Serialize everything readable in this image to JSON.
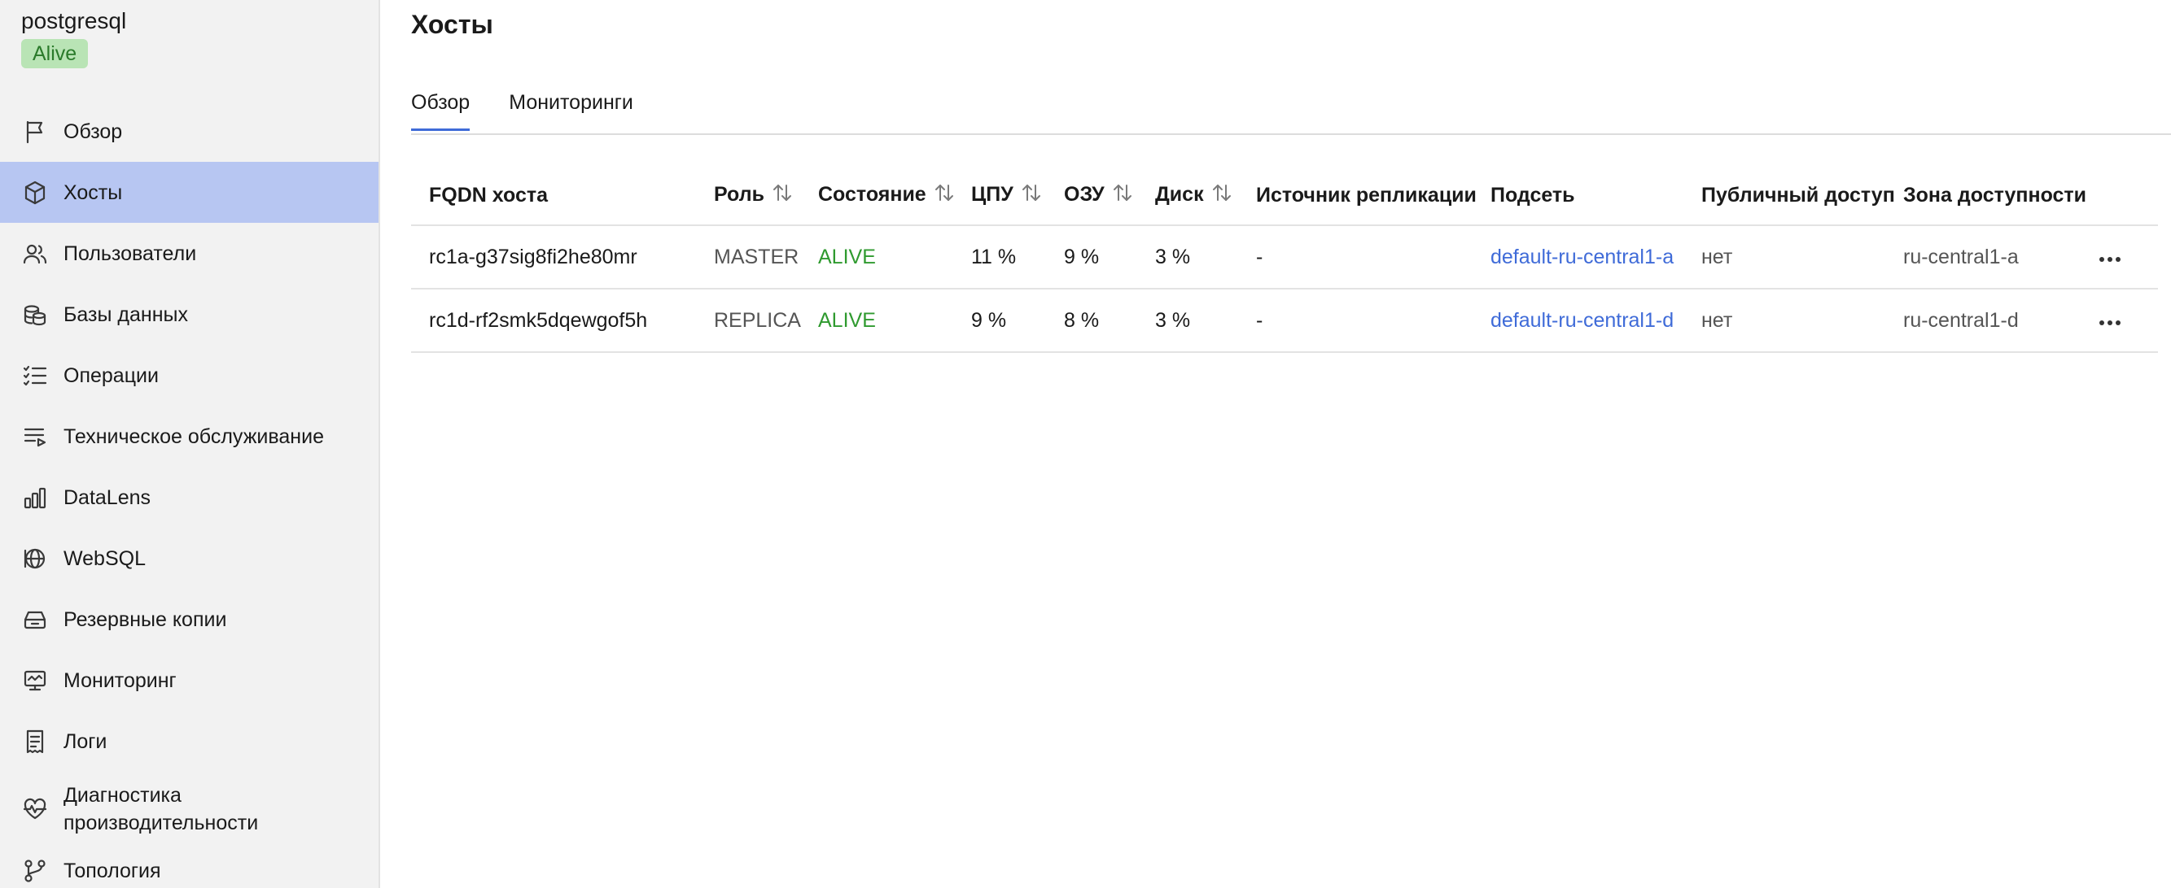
{
  "cluster": {
    "name": "postgresql",
    "status": "Alive"
  },
  "colors": {
    "active_nav": "#b7c6f2",
    "status_green": "#2f9a2f",
    "badge_bg": "#b9e4b5",
    "link": "#3f6bd8",
    "tab_underline": "#3f6bd8"
  },
  "sidebar": {
    "items": [
      {
        "label": "Обзор",
        "icon": "flag-icon"
      },
      {
        "label": "Хосты",
        "icon": "cube-icon",
        "active": true
      },
      {
        "label": "Пользователи",
        "icon": "users-icon"
      },
      {
        "label": "Базы данных",
        "icon": "databases-icon"
      },
      {
        "label": "Операции",
        "icon": "list-check-icon"
      },
      {
        "label": "Техническое обслуживание",
        "icon": "list-play-icon"
      },
      {
        "label": "DataLens",
        "icon": "chart-bars-icon"
      },
      {
        "label": "WebSQL",
        "icon": "globe-icon"
      },
      {
        "label": "Резервные копии",
        "icon": "archive-icon"
      },
      {
        "label": "Мониторинг",
        "icon": "monitor-icon"
      },
      {
        "label": "Логи",
        "icon": "receipt-icon"
      },
      {
        "label": "Диагностика производительности",
        "icon": "heart-pulse-icon"
      },
      {
        "label": "Топология",
        "icon": "topology-icon"
      }
    ]
  },
  "page": {
    "title": "Хосты"
  },
  "tabs": [
    {
      "label": "Обзор",
      "active": true
    },
    {
      "label": "Мониторинги"
    }
  ],
  "table": {
    "columns": [
      {
        "label": "FQDN хоста",
        "sortable": false
      },
      {
        "label": "Роль",
        "sortable": true
      },
      {
        "label": "Состояние",
        "sortable": true
      },
      {
        "label": "ЦПУ",
        "sortable": true
      },
      {
        "label": "ОЗУ",
        "sortable": true
      },
      {
        "label": "Диск",
        "sortable": true
      },
      {
        "label": "Источник репликации",
        "sortable": false
      },
      {
        "label": "Подсеть",
        "sortable": false
      },
      {
        "label": "Публичный доступ",
        "sortable": false
      },
      {
        "label": "Зона доступности",
        "sortable": false
      }
    ],
    "rows": [
      {
        "fqdn": "rc1a-g37sig8fi2he80mr",
        "role": "MASTER",
        "state": "ALIVE",
        "cpu": "11 %",
        "ram": "9 %",
        "disk": "3 %",
        "replication_source": "-",
        "subnet": "default-ru-central1-a",
        "public_access": "нет",
        "zone": "ru-central1-a"
      },
      {
        "fqdn": "rc1d-rf2smk5dqewgof5h",
        "role": "REPLICA",
        "state": "ALIVE",
        "cpu": "9 %",
        "ram": "8 %",
        "disk": "3 %",
        "replication_source": "-",
        "subnet": "default-ru-central1-d",
        "public_access": "нет",
        "zone": "ru-central1-d"
      }
    ]
  }
}
